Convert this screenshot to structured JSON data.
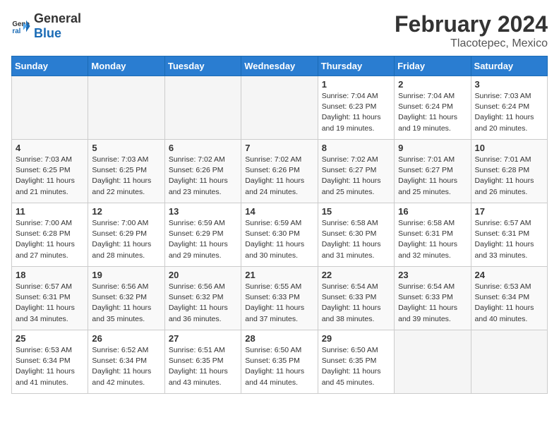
{
  "header": {
    "logo_general": "General",
    "logo_blue": "Blue",
    "main_title": "February 2024",
    "subtitle": "Tlacotepec, Mexico"
  },
  "days_of_week": [
    "Sunday",
    "Monday",
    "Tuesday",
    "Wednesday",
    "Thursday",
    "Friday",
    "Saturday"
  ],
  "weeks": [
    [
      {
        "day": "",
        "info": ""
      },
      {
        "day": "",
        "info": ""
      },
      {
        "day": "",
        "info": ""
      },
      {
        "day": "",
        "info": ""
      },
      {
        "day": "1",
        "info": "Sunrise: 7:04 AM\nSunset: 6:23 PM\nDaylight: 11 hours\nand 19 minutes."
      },
      {
        "day": "2",
        "info": "Sunrise: 7:04 AM\nSunset: 6:24 PM\nDaylight: 11 hours\nand 19 minutes."
      },
      {
        "day": "3",
        "info": "Sunrise: 7:03 AM\nSunset: 6:24 PM\nDaylight: 11 hours\nand 20 minutes."
      }
    ],
    [
      {
        "day": "4",
        "info": "Sunrise: 7:03 AM\nSunset: 6:25 PM\nDaylight: 11 hours\nand 21 minutes."
      },
      {
        "day": "5",
        "info": "Sunrise: 7:03 AM\nSunset: 6:25 PM\nDaylight: 11 hours\nand 22 minutes."
      },
      {
        "day": "6",
        "info": "Sunrise: 7:02 AM\nSunset: 6:26 PM\nDaylight: 11 hours\nand 23 minutes."
      },
      {
        "day": "7",
        "info": "Sunrise: 7:02 AM\nSunset: 6:26 PM\nDaylight: 11 hours\nand 24 minutes."
      },
      {
        "day": "8",
        "info": "Sunrise: 7:02 AM\nSunset: 6:27 PM\nDaylight: 11 hours\nand 25 minutes."
      },
      {
        "day": "9",
        "info": "Sunrise: 7:01 AM\nSunset: 6:27 PM\nDaylight: 11 hours\nand 25 minutes."
      },
      {
        "day": "10",
        "info": "Sunrise: 7:01 AM\nSunset: 6:28 PM\nDaylight: 11 hours\nand 26 minutes."
      }
    ],
    [
      {
        "day": "11",
        "info": "Sunrise: 7:00 AM\nSunset: 6:28 PM\nDaylight: 11 hours\nand 27 minutes."
      },
      {
        "day": "12",
        "info": "Sunrise: 7:00 AM\nSunset: 6:29 PM\nDaylight: 11 hours\nand 28 minutes."
      },
      {
        "day": "13",
        "info": "Sunrise: 6:59 AM\nSunset: 6:29 PM\nDaylight: 11 hours\nand 29 minutes."
      },
      {
        "day": "14",
        "info": "Sunrise: 6:59 AM\nSunset: 6:30 PM\nDaylight: 11 hours\nand 30 minutes."
      },
      {
        "day": "15",
        "info": "Sunrise: 6:58 AM\nSunset: 6:30 PM\nDaylight: 11 hours\nand 31 minutes."
      },
      {
        "day": "16",
        "info": "Sunrise: 6:58 AM\nSunset: 6:31 PM\nDaylight: 11 hours\nand 32 minutes."
      },
      {
        "day": "17",
        "info": "Sunrise: 6:57 AM\nSunset: 6:31 PM\nDaylight: 11 hours\nand 33 minutes."
      }
    ],
    [
      {
        "day": "18",
        "info": "Sunrise: 6:57 AM\nSunset: 6:31 PM\nDaylight: 11 hours\nand 34 minutes."
      },
      {
        "day": "19",
        "info": "Sunrise: 6:56 AM\nSunset: 6:32 PM\nDaylight: 11 hours\nand 35 minutes."
      },
      {
        "day": "20",
        "info": "Sunrise: 6:56 AM\nSunset: 6:32 PM\nDaylight: 11 hours\nand 36 minutes."
      },
      {
        "day": "21",
        "info": "Sunrise: 6:55 AM\nSunset: 6:33 PM\nDaylight: 11 hours\nand 37 minutes."
      },
      {
        "day": "22",
        "info": "Sunrise: 6:54 AM\nSunset: 6:33 PM\nDaylight: 11 hours\nand 38 minutes."
      },
      {
        "day": "23",
        "info": "Sunrise: 6:54 AM\nSunset: 6:33 PM\nDaylight: 11 hours\nand 39 minutes."
      },
      {
        "day": "24",
        "info": "Sunrise: 6:53 AM\nSunset: 6:34 PM\nDaylight: 11 hours\nand 40 minutes."
      }
    ],
    [
      {
        "day": "25",
        "info": "Sunrise: 6:53 AM\nSunset: 6:34 PM\nDaylight: 11 hours\nand 41 minutes."
      },
      {
        "day": "26",
        "info": "Sunrise: 6:52 AM\nSunset: 6:34 PM\nDaylight: 11 hours\nand 42 minutes."
      },
      {
        "day": "27",
        "info": "Sunrise: 6:51 AM\nSunset: 6:35 PM\nDaylight: 11 hours\nand 43 minutes."
      },
      {
        "day": "28",
        "info": "Sunrise: 6:50 AM\nSunset: 6:35 PM\nDaylight: 11 hours\nand 44 minutes."
      },
      {
        "day": "29",
        "info": "Sunrise: 6:50 AM\nSunset: 6:35 PM\nDaylight: 11 hours\nand 45 minutes."
      },
      {
        "day": "",
        "info": ""
      },
      {
        "day": "",
        "info": ""
      }
    ]
  ]
}
